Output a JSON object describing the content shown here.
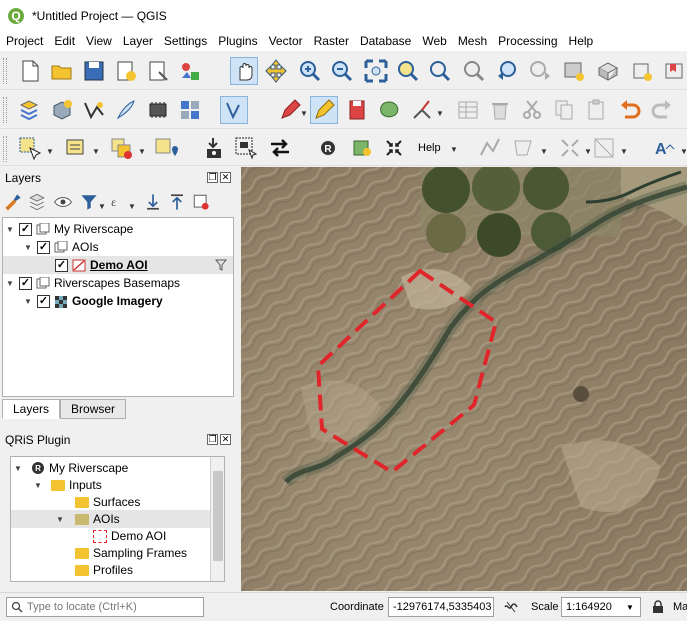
{
  "window": {
    "title": "*Untitled Project — QGIS"
  },
  "menu": [
    "Project",
    "Edit",
    "View",
    "Layer",
    "Settings",
    "Plugins",
    "Vector",
    "Raster",
    "Database",
    "Web",
    "Mesh",
    "Processing",
    "Help"
  ],
  "toolbar": {
    "help_label": "Help"
  },
  "layers_panel": {
    "title": "Layers",
    "tree": [
      {
        "label": "My Riverscape",
        "level": 0,
        "checked": true,
        "expanded": true
      },
      {
        "label": "AOIs",
        "level": 1,
        "checked": true,
        "expanded": true
      },
      {
        "label": "Demo AOI",
        "level": 2,
        "checked": true
      },
      {
        "label": "Riverscapes Basemaps",
        "level": 0,
        "checked": true,
        "expanded": true
      },
      {
        "label": "Google Imagery",
        "level": 1,
        "checked": true
      }
    ],
    "tabs": [
      "Layers",
      "Browser"
    ]
  },
  "qris_panel": {
    "title": "QRiS Plugin",
    "tree": [
      {
        "label": "My Riverscape",
        "level": 0
      },
      {
        "label": "Inputs",
        "level": 1
      },
      {
        "label": "Surfaces",
        "level": 2
      },
      {
        "label": "AOIs",
        "level": 2
      },
      {
        "label": "Demo AOI",
        "level": 3
      },
      {
        "label": "Sampling Frames",
        "level": 2
      },
      {
        "label": "Profiles",
        "level": 2
      }
    ]
  },
  "status": {
    "locate_placeholder": "Type to locate (Ctrl+K)",
    "coordinate_label": "Coordinate",
    "coordinate_value": "-12976174,5335403",
    "scale_label": "Scale",
    "scale_value": "1:164920",
    "magnifier_label": "Ma"
  },
  "colors": {
    "aoi_outline": "#e0262b",
    "selection": "#e5e5e5",
    "folder": "#f4c430"
  }
}
